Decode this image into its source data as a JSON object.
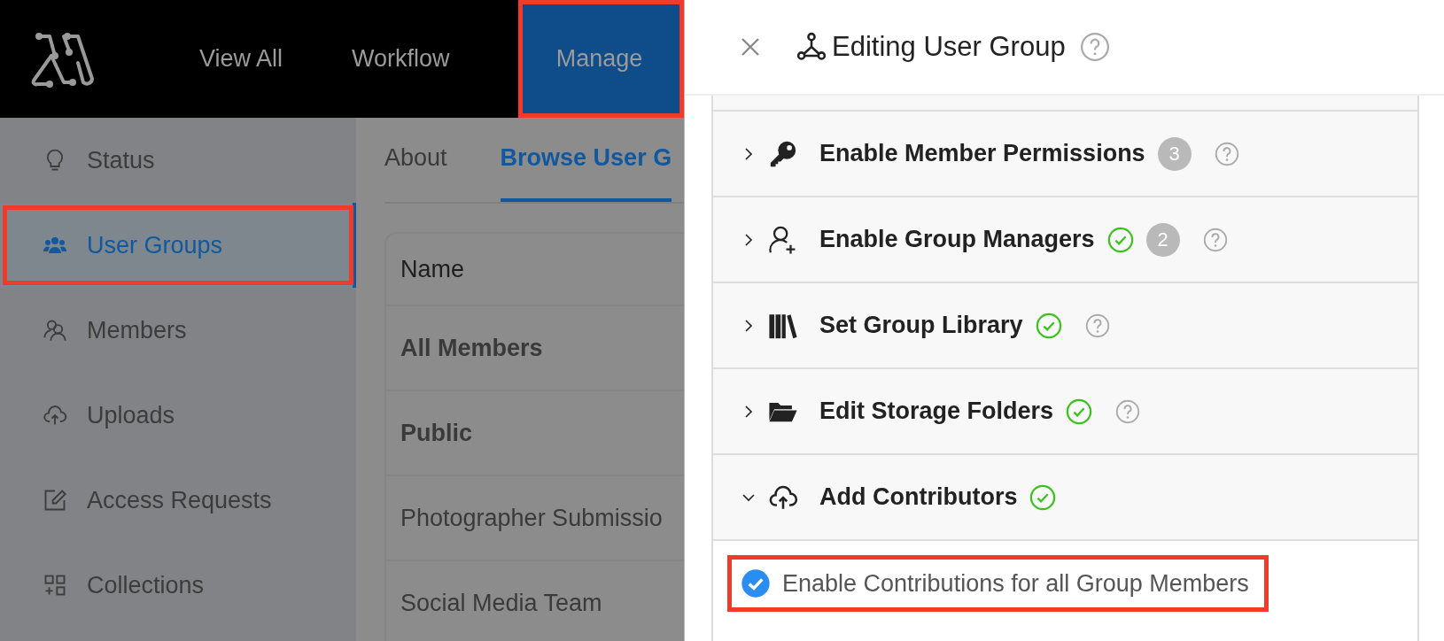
{
  "nav": {
    "items": [
      {
        "label": "View All",
        "selected": false,
        "highlighted": false
      },
      {
        "label": "Workflow",
        "selected": false,
        "highlighted": false
      },
      {
        "label": "Manage",
        "selected": true,
        "highlighted": true
      }
    ]
  },
  "sidebar": {
    "items": [
      {
        "label": "Status",
        "selected": false,
        "highlighted": false
      },
      {
        "label": "User Groups",
        "selected": true,
        "highlighted": true
      },
      {
        "label": "Members",
        "selected": false,
        "highlighted": false
      },
      {
        "label": "Uploads",
        "selected": false,
        "highlighted": false
      },
      {
        "label": "Access Requests",
        "selected": false,
        "highlighted": false
      },
      {
        "label": "Collections",
        "selected": false,
        "highlighted": false
      }
    ]
  },
  "content": {
    "tabs": [
      {
        "label": "About",
        "selected": false
      },
      {
        "label": "Browse User G",
        "selected": true
      }
    ],
    "table": {
      "columns": [
        "Name"
      ],
      "rows": [
        {
          "name": "All Members",
          "bold": true
        },
        {
          "name": "Public",
          "bold": true
        },
        {
          "name": "Photographer Submissio",
          "bold": false
        },
        {
          "name": "Social Media Team",
          "bold": false
        }
      ]
    }
  },
  "panel": {
    "title": "Editing User Group",
    "sections": [
      {
        "title": "Enable Member Permissions",
        "complete": false,
        "count": "3",
        "help": true,
        "expanded": false
      },
      {
        "title": "Enable Group Managers",
        "complete": true,
        "count": "2",
        "help": true,
        "expanded": false
      },
      {
        "title": "Set Group Library",
        "complete": true,
        "help": true,
        "expanded": false
      },
      {
        "title": "Edit Storage Folders",
        "complete": true,
        "help": true,
        "expanded": false
      },
      {
        "title": "Add Contributors",
        "complete": true,
        "help": false,
        "expanded": true
      }
    ],
    "option": {
      "label": "Enable Contributions for all Group Members",
      "checked": true,
      "highlighted": true
    }
  }
}
